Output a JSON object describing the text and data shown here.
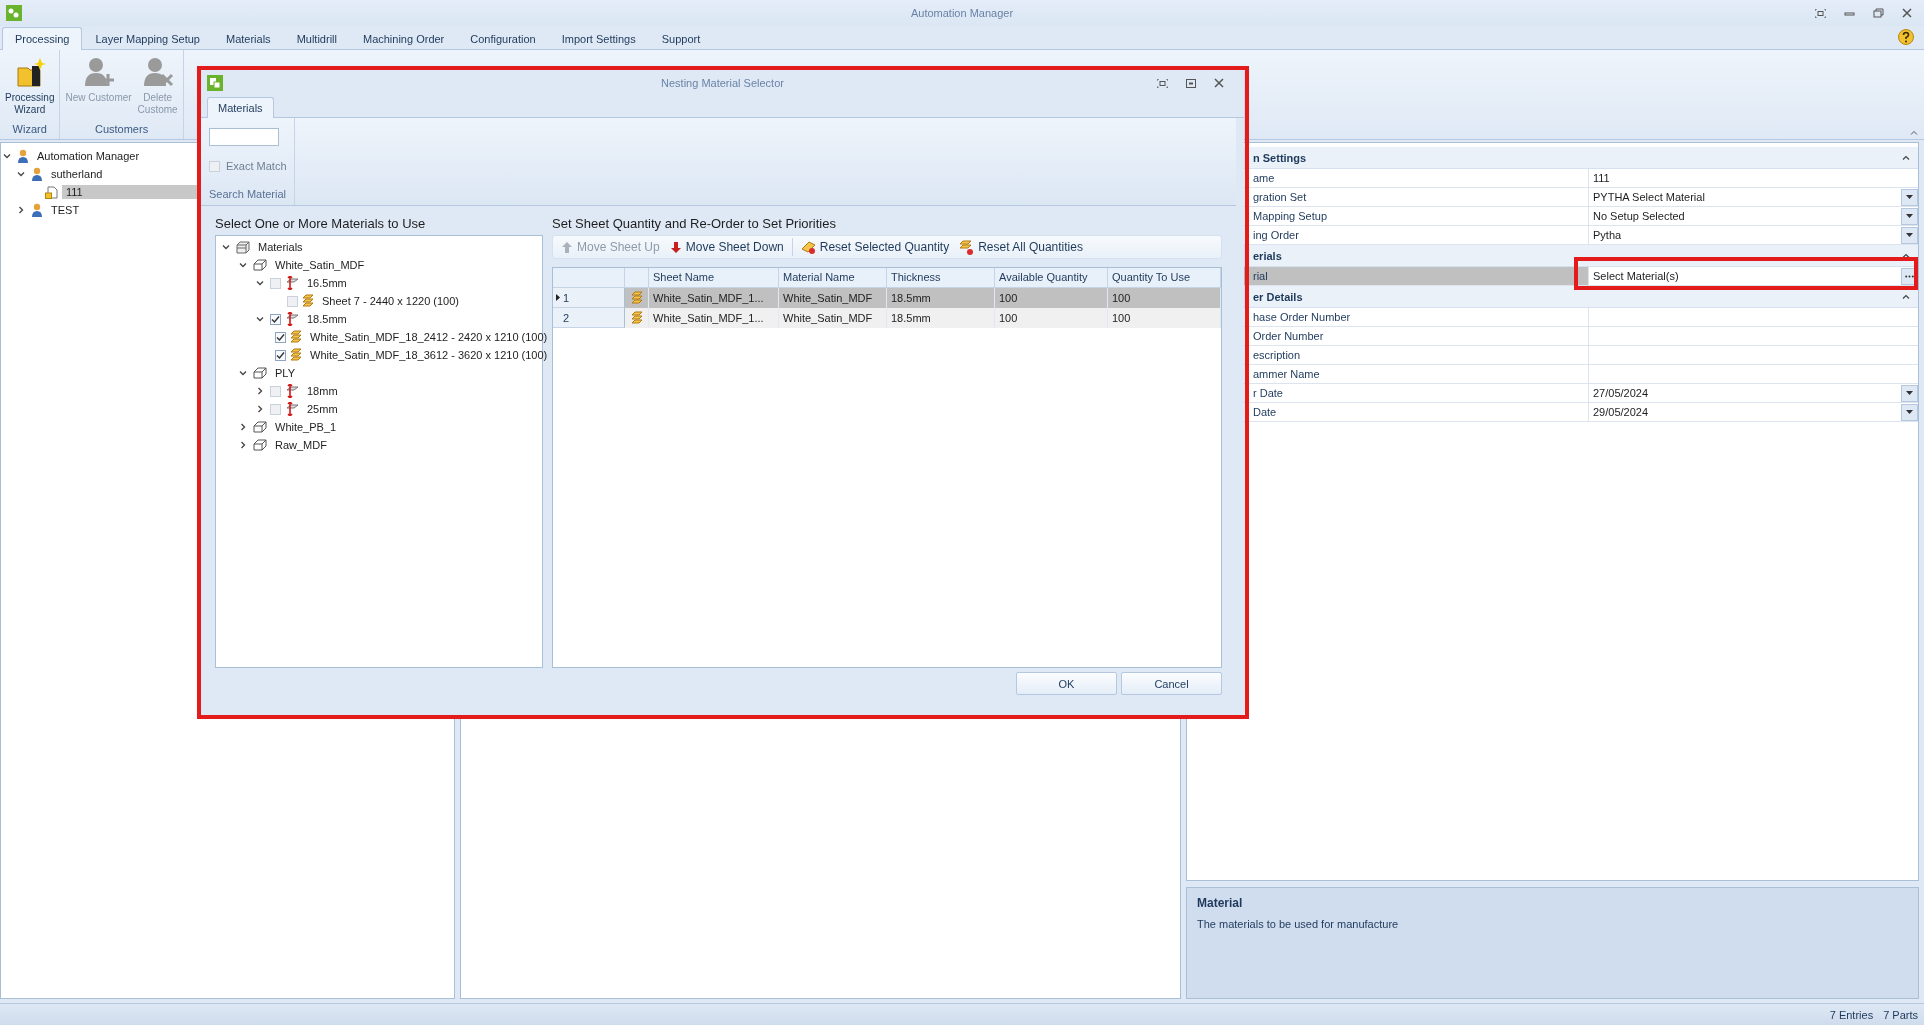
{
  "window": {
    "title": "Automation Manager"
  },
  "ribbon_tabs": [
    {
      "label": "Processing",
      "selected": true
    },
    {
      "label": "Layer Mapping Setup",
      "selected": false
    },
    {
      "label": "Materials",
      "selected": false
    },
    {
      "label": "Multidrill",
      "selected": false
    },
    {
      "label": "Machining Order",
      "selected": false
    },
    {
      "label": "Configuration",
      "selected": false
    },
    {
      "label": "Import Settings",
      "selected": false
    },
    {
      "label": "Support",
      "selected": false
    }
  ],
  "ribbon_groups": [
    {
      "label": "Wizard",
      "buttons": [
        {
          "lines": [
            "Processing",
            "Wizard"
          ],
          "kind": "wizard",
          "disabled": false
        }
      ]
    },
    {
      "label": "Customers",
      "buttons": [
        {
          "lines": [
            "New Customer"
          ],
          "kind": "add_user",
          "disabled": true
        },
        {
          "lines": [
            "Delete",
            "Custome"
          ],
          "kind": "delete_user",
          "disabled": true
        }
      ]
    }
  ],
  "project_tree": [
    {
      "label": "Automation Manager",
      "kind": "user",
      "expanded": true,
      "selected": false,
      "children": [
        {
          "label": "sutherland",
          "kind": "user",
          "expanded": true,
          "selected": false,
          "children": [
            {
              "label": "111",
              "kind": "job",
              "selected": true
            }
          ]
        },
        {
          "label": "TEST",
          "kind": "user",
          "expanded": false,
          "selected": false
        }
      ]
    }
  ],
  "properties": [
    {
      "title": "n Settings",
      "expanded": true,
      "rows": [
        {
          "label": "ame",
          "value": "111",
          "kind": "plain",
          "selected": false
        },
        {
          "label": "gration Set",
          "value": "PYTHA Select Material",
          "kind": "dropdown",
          "selected": false
        },
        {
          "label": "Mapping Setup",
          "value": "No Setup Selected",
          "kind": "dropdown",
          "selected": false
        },
        {
          "label": "ing Order",
          "value": "Pytha",
          "kind": "dropdown",
          "selected": false
        }
      ]
    },
    {
      "title": "erials",
      "expanded": true,
      "rows": [
        {
          "label": "rial",
          "value": "Select Material(s)",
          "kind": "ellipsis",
          "selected": true
        }
      ]
    },
    {
      "title": "er Details",
      "expanded": true,
      "rows": [
        {
          "label": "hase Order Number",
          "kind": "plain",
          "selected": false
        },
        {
          "label": "Order Number",
          "kind": "plain",
          "selected": false
        },
        {
          "label": "escription",
          "kind": "plain",
          "selected": false
        },
        {
          "label": "ammer Name",
          "kind": "plain",
          "selected": false
        },
        {
          "label": "r Date",
          "value": "27/05/2024",
          "kind": "dropdown",
          "selected": false
        },
        {
          "label": "Date",
          "value": "29/05/2024",
          "kind": "dropdown",
          "selected": false
        }
      ]
    }
  ],
  "description": {
    "title": "Material",
    "text": "The materials to be used for manufacture"
  },
  "status_bar": [
    "7 Entries",
    "7 Parts"
  ],
  "dialog": {
    "title": "Nesting Material Selector",
    "tabs": [
      {
        "label": "Materials",
        "selected": true
      }
    ],
    "exact_match": {
      "label": "Exact Match",
      "checked": false,
      "disabled": true
    },
    "group_label": "Search Material",
    "left_heading": "Select One or More Materials to Use",
    "material_tree": [
      {
        "label": "Materials",
        "kind": "root",
        "expanded": true,
        "children": [
          {
            "label": "White_Satin_MDF",
            "kind": "material",
            "expanded": true,
            "children": [
              {
                "label": "16.5mm",
                "kind": "thickness",
                "expanded": true,
                "checked": false,
                "children": [
                  {
                    "label": "Sheet 7 - 2440 x 1220 (100)",
                    "kind": "sheet",
                    "checked": false
                  }
                ]
              },
              {
                "label": "18.5mm",
                "kind": "thickness",
                "expanded": true,
                "checked": true,
                "children": [
                  {
                    "label": "White_Satin_MDF_18_2412 - 2420 x 1210 (100)",
                    "kind": "sheet",
                    "checked": true
                  },
                  {
                    "label": "White_Satin_MDF_18_3612 - 3620 x 1210 (100)",
                    "kind": "sheet",
                    "checked": true
                  }
                ]
              }
            ]
          },
          {
            "label": "PLY",
            "kind": "material",
            "expanded": true,
            "children": [
              {
                "label": "18mm",
                "kind": "thickness",
                "expanded": false,
                "checked": false
              },
              {
                "label": "25mm",
                "kind": "thickness",
                "expanded": false,
                "checked": false
              }
            ]
          },
          {
            "label": "White_PB_1",
            "kind": "material",
            "expanded": false
          },
          {
            "label": "Raw_MDF",
            "kind": "material",
            "expanded": false
          }
        ]
      }
    ],
    "right_heading": "Set Sheet Quantity and Re-Order to Set Priorities",
    "toolbar": [
      {
        "label": "Move Sheet Up",
        "kind": "up",
        "disabled": true,
        "separator_before": false
      },
      {
        "label": "Move Sheet Down",
        "kind": "down",
        "disabled": false,
        "separator_before": false
      },
      {
        "label": "Reset Selected Quantity",
        "kind": "reset",
        "disabled": false,
        "separator_before": true
      },
      {
        "label": "Reset All Quantities",
        "kind": "reset_all",
        "disabled": false,
        "separator_before": false
      }
    ],
    "columns": [
      "Sheet Name",
      "Material Name",
      "Thickness",
      "Available Quantity",
      "Quantity To Use"
    ],
    "rows": [
      {
        "index": "1",
        "current": true,
        "selected": true,
        "cells": [
          "White_Satin_MDF_1...",
          "White_Satin_MDF",
          "18.5mm",
          "100",
          "100"
        ]
      },
      {
        "index": "2",
        "current": false,
        "selected": false,
        "cells": [
          "White_Satin_MDF_1...",
          "White_Satin_MDF",
          "18.5mm",
          "100",
          "100"
        ]
      }
    ],
    "buttons": [
      "OK",
      "Cancel"
    ]
  }
}
